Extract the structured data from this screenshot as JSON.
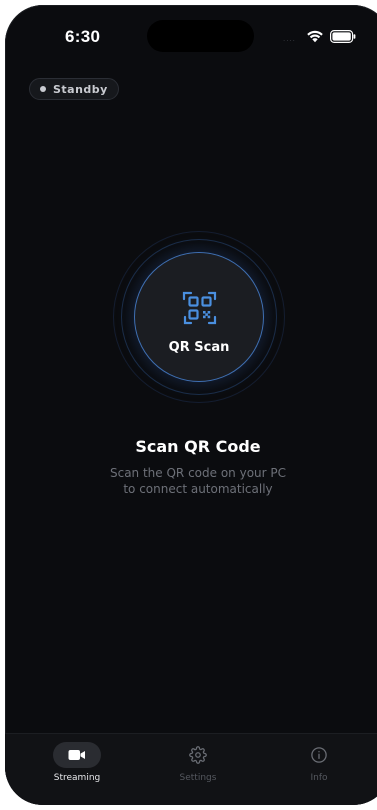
{
  "status_bar": {
    "time": "6:30",
    "signal": "....",
    "wifi_icon": "wifi-icon",
    "battery_icon": "battery-icon"
  },
  "status_badge": {
    "label": "Standby"
  },
  "scan_button": {
    "label": "QR Scan",
    "icon": "qr-code-icon"
  },
  "main": {
    "title": "Scan QR Code",
    "description_line1": "Scan the QR code on your PC",
    "description_line2": "to connect automatically"
  },
  "tab_bar": {
    "tabs": [
      {
        "label": "Streaming",
        "icon": "video-camera-icon",
        "active": true
      },
      {
        "label": "Settings",
        "icon": "gear-icon",
        "active": false
      },
      {
        "label": "Info",
        "icon": "info-icon",
        "active": false
      }
    ]
  },
  "colors": {
    "background": "#0b0c0f",
    "accent": "#4a8fe0",
    "text_primary": "#ffffff",
    "text_secondary": "#6d7078",
    "tab_inactive": "#55585f"
  }
}
